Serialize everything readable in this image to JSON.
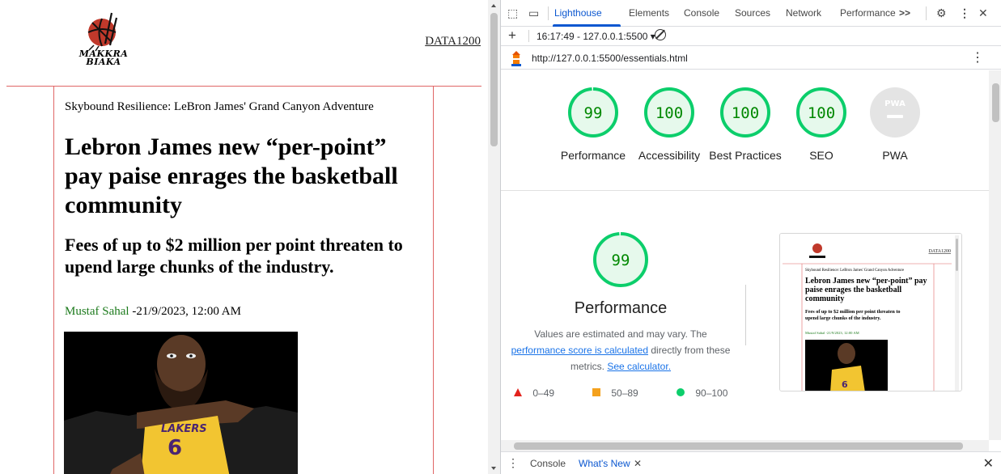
{
  "site": {
    "logo_text_line1": "MAKKRA",
    "logo_text_line2": "BIAKA",
    "nav_link": "DATA1200",
    "kicker": "Skybound Resilience: LeBron James' Grand Canyon Adventure",
    "headline": "Lebron James new “per-point” pay paise enrages the basketball community",
    "subhead": "Fees of up to $2 million per point threaten to upend large chunks of the industry.",
    "byline_author": "Mustaf Sahal",
    "byline_date": " -21/9/2023, 12:00 AM",
    "jersey_brand": "LAKERS",
    "jersey_number": "6"
  },
  "devtools": {
    "tabs": [
      "Lighthouse",
      "Elements",
      "Console",
      "Sources",
      "Network",
      "Performance"
    ],
    "more_tabs": ">>",
    "report_select": "16:17:49 - 127.0.0.1:5500 ▾",
    "url": "http://127.0.0.1:5500/essentials.html",
    "scores": [
      {
        "value": 99,
        "display": "99",
        "label": "Performance"
      },
      {
        "value": 100,
        "display": "100",
        "label": "Accessibility"
      },
      {
        "value": 100,
        "display": "100",
        "label": "Best Practices"
      },
      {
        "value": 100,
        "display": "100",
        "label": "SEO"
      }
    ],
    "pwa_label": "PWA",
    "pwa_badge": "PWA",
    "performance": {
      "score": 99,
      "score_display": "99",
      "title": "Performance",
      "desc_prefix": "Values are estimated and may vary. The ",
      "desc_link1": "performance score is calculated",
      "desc_middle": " directly from these metrics. ",
      "desc_link2": "See calculator."
    },
    "legend": [
      {
        "range": "0–49",
        "color": "#e3231d",
        "shape": "triangle"
      },
      {
        "range": "50–89",
        "color": "#f4a11d",
        "shape": "square"
      },
      {
        "range": "90–100",
        "color": "#0cce6b",
        "shape": "circle"
      }
    ],
    "drawer_tabs": [
      "Console",
      "What's New"
    ],
    "colors": {
      "pass": "#0cce6b",
      "pass_text": "#008800",
      "pass_fill": "#e6f9ec",
      "accent": "#0b57d0",
      "rule": "#e06666"
    }
  },
  "thumbnail": {
    "nav_link": "DATA1200",
    "kicker": "Skybound Resilience: LeBron James' Grand Canyon Adventure",
    "headline": "Lebron James new “per-point” pay paise enrages the basketball community",
    "subhead": "Fees of up to $2 million per point threaten to upend large chunks of the industry.",
    "byline": "Mustaf Sahal -21/9/2023, 12:00 AM",
    "jersey_number": "6"
  }
}
